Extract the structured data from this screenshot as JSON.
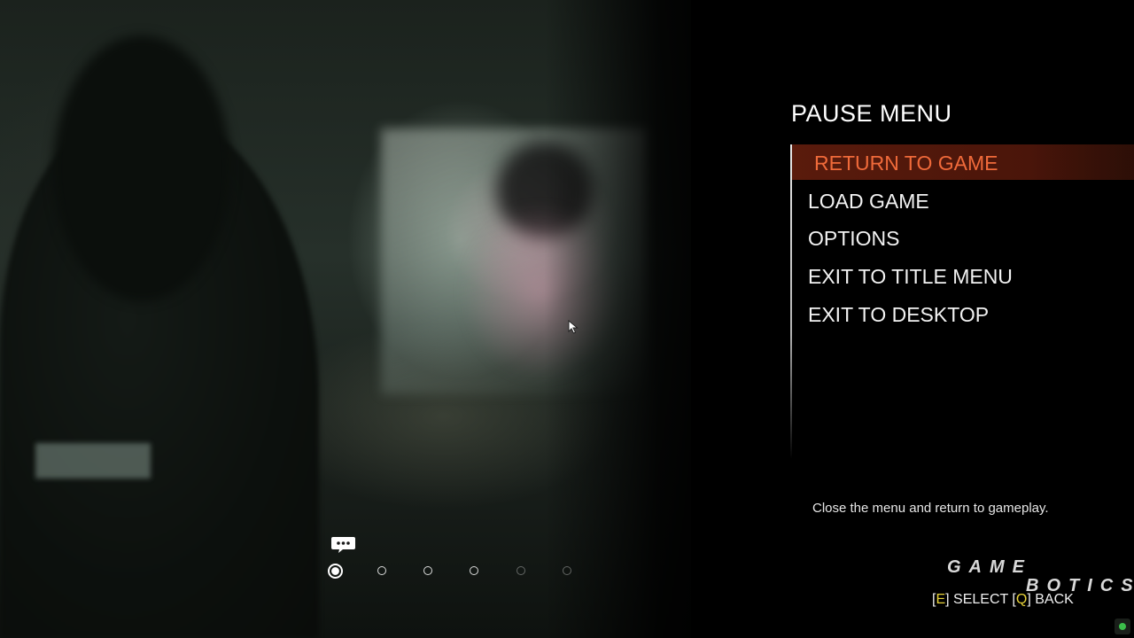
{
  "menu": {
    "title": "PAUSE MENU",
    "items": [
      {
        "label": "RETURN TO GAME",
        "selected": true
      },
      {
        "label": "LOAD GAME"
      },
      {
        "label": "OPTIONS"
      },
      {
        "label": "EXIT TO TITLE MENU"
      },
      {
        "label": "EXIT TO DESKTOP"
      }
    ],
    "description": "Close the menu and return to gameplay."
  },
  "controls": {
    "select_key_open": "[",
    "select_key": "E",
    "select_key_close": "]",
    "select_label": " SELECT ",
    "back_key_open": "[",
    "back_key": "Q",
    "back_key_close": "]",
    "back_label": " BACK"
  },
  "watermark": {
    "line1": "GAME",
    "line2": "BOTICS"
  },
  "pagination": {
    "count": 6,
    "active_index": 0
  },
  "colors": {
    "accent": "#f06a3a",
    "selected_bg": "#5a1b0c",
    "key_highlight": "#e8d33a",
    "status_led": "#3bbd4a"
  },
  "icons": {
    "chat": "chat-bubble-icon",
    "cursor": "mouse-cursor-icon",
    "status": "status-led-icon"
  }
}
